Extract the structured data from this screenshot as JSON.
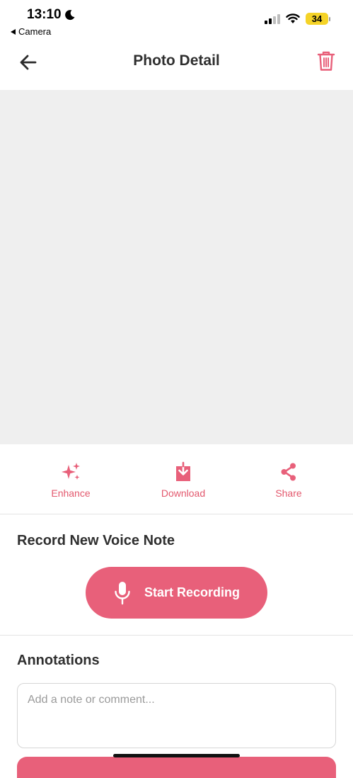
{
  "status_bar": {
    "time": "13:10",
    "back_app": "Camera",
    "battery": "34"
  },
  "header": {
    "title": "Photo Detail"
  },
  "actions": [
    {
      "label": "Enhance",
      "icon": "sparkles-icon"
    },
    {
      "label": "Download",
      "icon": "download-icon"
    },
    {
      "label": "Share",
      "icon": "share-icon"
    }
  ],
  "voice": {
    "title": "Record New Voice Note",
    "button_label": "Start Recording"
  },
  "annotations": {
    "title": "Annotations",
    "placeholder": "Add a note or comment...",
    "value": ""
  },
  "colors": {
    "accent": "#e8607a",
    "accent_text": "#e3586d",
    "photo_bg": "#efefef"
  }
}
